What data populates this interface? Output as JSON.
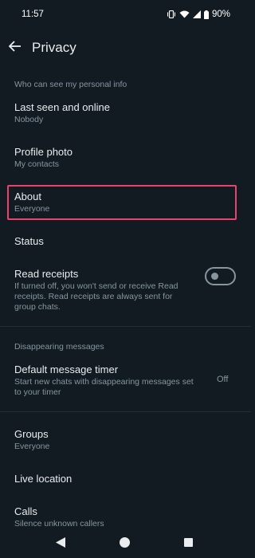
{
  "status_bar": {
    "time": "11:57",
    "battery": "90%"
  },
  "header": {
    "title": "Privacy"
  },
  "sections": {
    "personal_info_header": "Who can see my personal info",
    "last_seen": {
      "title": "Last seen and online",
      "value": "Nobody"
    },
    "profile_photo": {
      "title": "Profile photo",
      "value": "My contacts"
    },
    "about": {
      "title": "About",
      "value": "Everyone"
    },
    "status": {
      "title": "Status"
    },
    "read_receipts": {
      "title": "Read receipts",
      "desc_lines": [
        "If turned off, you won't send or receive Read",
        "receipts. Read receipts are always sent for",
        "group chats."
      ],
      "enabled": false
    },
    "disappearing_header": "Disappearing messages",
    "default_timer": {
      "title": "Default message timer",
      "desc_lines": [
        "Start new chats with disappearing messages set",
        "to your timer"
      ],
      "value": "Off"
    },
    "groups": {
      "title": "Groups",
      "value": "Everyone"
    },
    "live_location": {
      "title": "Live location"
    },
    "calls": {
      "title": "Calls",
      "value": "Silence unknown callers"
    }
  },
  "colors": {
    "background": "#111b21",
    "primary_text": "#e9edef",
    "secondary_text": "#8696a0",
    "highlight_border": "#e8436c"
  },
  "icons": {
    "back": "arrow-left-icon",
    "vibrate": "vibrate-icon",
    "wifi": "wifi-icon",
    "signal": "signal-icon",
    "battery": "battery-icon"
  }
}
